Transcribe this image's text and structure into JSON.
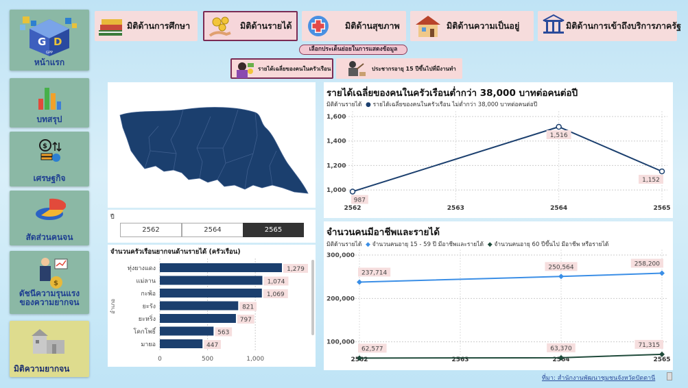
{
  "sidebar": {
    "items": [
      {
        "label": "หน้าแรก",
        "icon": "gpp-logo-icon",
        "logo_text": "GPP"
      },
      {
        "label": "บทสรุป",
        "icon": "bar-chart-icon"
      },
      {
        "label": "เศรษฐกิจ",
        "icon": "money-icon"
      },
      {
        "label": "สัดส่วนคนจน",
        "icon": "pie-chart-icon"
      },
      {
        "label": "ดัชนีความรุนแรง\nของความยากจน",
        "icon": "businessman-icon"
      },
      {
        "label": "มิติความยากจน",
        "icon": "poverty-house-icon"
      }
    ]
  },
  "tabs": [
    {
      "label": "มิติด้านการศึกษา",
      "icon": "books-icon"
    },
    {
      "label": "มิติด้านรายได้",
      "icon": "coins-hand-icon"
    },
    {
      "label": "มิติด้านสุขภาพ",
      "icon": "health-cross-icon"
    },
    {
      "label": "มิติด้านความเป็นอยู่",
      "icon": "house-icon"
    },
    {
      "label": "มิติด้านการเข้าถึงบริการภาครัฐ",
      "icon": "handshake-icon"
    }
  ],
  "subsection": {
    "title": "เลือกประเด็นย่อยในการแสดงข้อมูล",
    "buttons": [
      {
        "label": "รายได้เฉลี่ยของคนในครัวเรือน",
        "icon": "woman-money-icon"
      },
      {
        "label": "ประชากรอายุ 15 ปีขึ้นไปที่มีงานทำ",
        "icon": "worker-icon"
      }
    ]
  },
  "year_filter": {
    "label": "ปี",
    "options": [
      "2562",
      "2564",
      "2565"
    ],
    "selected": "2565"
  },
  "bar_chart_title": "จำนวนครัวเรือนยากจนด้านรายได้ (ครัวเรือน)",
  "line1_title": "รายได้เฉลี่ยของคนในครัวเรือนต่ำกว่า 38,000 บาทต่อคนต่อปี",
  "line1_legend": {
    "group": "มิติด้านรายได้",
    "series": [
      "รายได้เฉลี่ยของคนในครัวเรือน ไม่ต่ำกว่า 38,000 บาทต่อคนต่อปี"
    ]
  },
  "line2_title": "จำนวนคนมีอาชีพและรายได้",
  "line2_legend": {
    "group": "มิติด้านรายได้",
    "series": [
      "จำนวนคนอายุ 15 - 59 ปี มีอาชีพและรายได้",
      "จำนวนคนอายุ 60 ปีขึ้นไป มีอาชีพ หรือรายได้"
    ]
  },
  "source": "ที่มา: สำนักงานพัฒนาชุมชนจังหวัดปัตตานี",
  "colors": {
    "navy": "#1b3f6e",
    "blue": "#3a8ee6",
    "dark_green": "#1f4a3a",
    "label_bg": "#f6dede"
  },
  "chart_data": [
    {
      "type": "bar",
      "orientation": "horizontal",
      "ylabel": "อำเภอ",
      "categories": [
        "ทุ่งยางแดง",
        "แม่ลาน",
        "กะพ้อ",
        "ยะรัง",
        "ยะหริ่ง",
        "โคกโพธิ์",
        "มายอ"
      ],
      "values": [
        1279,
        1074,
        1069,
        821,
        797,
        563,
        447
      ],
      "value_labels": [
        "1,279",
        "1,074",
        "1,069",
        "821",
        "797",
        "563",
        "447"
      ],
      "xlim": [
        0,
        1279
      ],
      "xticks": [
        0,
        500,
        1000
      ],
      "xtick_labels": [
        "0",
        "500",
        "1,000"
      ],
      "grid": true
    },
    {
      "type": "line",
      "x": [
        "2562",
        "2563",
        "2564",
        "2565"
      ],
      "series": [
        {
          "name": "รายได้เฉลี่ยของคนในครัวเรือน ไม่ต่ำกว่า 38,000 บาทต่อคนต่อปี",
          "points": [
            [
              "2562",
              987
            ],
            [
              "2564",
              1516
            ],
            [
              "2565",
              1152
            ]
          ],
          "labels": [
            "987",
            "1,516",
            "1,152"
          ]
        }
      ],
      "ylim": [
        900,
        1600
      ],
      "yticks": [
        1000,
        1200,
        1400,
        1600
      ],
      "ytick_labels": [
        "1,000",
        "1,200",
        "1,400",
        "1,600"
      ],
      "grid": true
    },
    {
      "type": "line",
      "x": [
        "2562",
        "2563",
        "2564",
        "2565"
      ],
      "series": [
        {
          "name": "จำนวนคนอายุ 15 - 59 ปี มีอาชีพและรายได้",
          "points": [
            [
              "2562",
              237714
            ],
            [
              "2564",
              250564
            ],
            [
              "2565",
              258200
            ]
          ],
          "labels": [
            "237,714",
            "250,564",
            "258,200"
          ]
        },
        {
          "name": "จำนวนคนอายุ 60 ปีขึ้นไป มีอาชีพ หรือรายได้",
          "points": [
            [
              "2562",
              62577
            ],
            [
              "2564",
              63370
            ],
            [
              "2565",
              71315
            ]
          ],
          "labels": [
            "62,577",
            "63,370",
            "71,315"
          ]
        }
      ],
      "ylim": [
        60000,
        300000
      ],
      "yticks": [
        100000,
        200000,
        300000
      ],
      "ytick_labels": [
        "100,000",
        "200,000",
        "300,000"
      ],
      "grid": true
    }
  ]
}
